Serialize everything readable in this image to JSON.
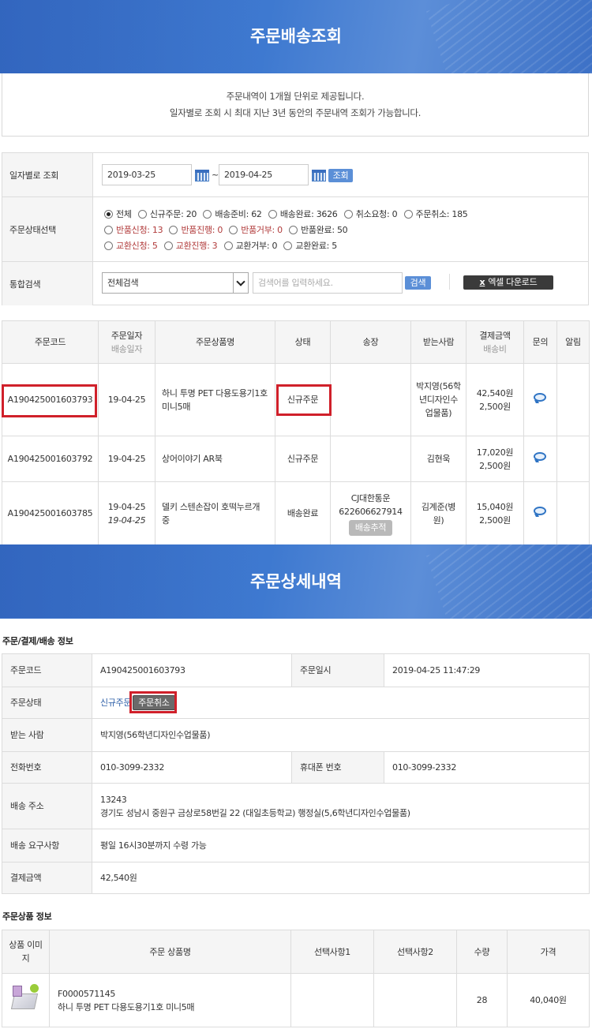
{
  "banner_top": {
    "title": "주문배송조회"
  },
  "notice": {
    "line1": "주문내역이 1개월 단위로 제공됩니다.",
    "line2": "일자별로 조회 시 최대 지난 3년 동안의 주문내역 조회가 가능합니다."
  },
  "search": {
    "date_label": "일자별로 조회",
    "date_from": "2019-03-25",
    "date_sep": "~",
    "date_to": "2019-04-25",
    "date_button": "조회",
    "status_label": "주문상태선택",
    "status_options": [
      [
        "전체",
        "신규주문: 20",
        "배송준비: 62",
        "배송완료: 3626",
        "취소요청: 0",
        "주문취소: 185"
      ],
      [
        "반품신청: 13",
        "반품진행: 0",
        "반품거부: 0",
        "반품완료: 50"
      ],
      [
        "교환신청: 5",
        "교환진행: 3",
        "교환거부: 0",
        "교환완료: 5"
      ]
    ],
    "integrated_label": "통합검색",
    "scope_selected": "전체검색",
    "keyword_placeholder": "검색어를 입력하세요.",
    "search_button": "검색",
    "excel_icon": "x",
    "excel_button": "엑셀 다운로드"
  },
  "orders": {
    "headers": {
      "code": "주문코드",
      "date": "주문일자",
      "date_sub": "배송일자",
      "product": "주문상품명",
      "status": "상태",
      "invoice": "송장",
      "receiver": "받는사람",
      "amount": "결제금액",
      "amount_sub": "배송비",
      "inquiry": "문의",
      "alert": "알림"
    },
    "rows": [
      {
        "code": "A190425001603793",
        "date": "19-04-25",
        "ship_date": "",
        "product": "하니 투명 PET 다용도용기1호 미니5매",
        "status": "신규주문",
        "carrier": "",
        "invoice": "",
        "track": "",
        "receiver": "박지영(56학년디자인수업물품)",
        "amount": "42,540원",
        "shipping": "2,500원"
      },
      {
        "code": "A190425001603792",
        "date": "19-04-25",
        "ship_date": "",
        "product": "상어이야기 AR북",
        "status": "신규주문",
        "carrier": "",
        "invoice": "",
        "track": "",
        "receiver": "김현욱",
        "amount": "17,020원",
        "shipping": "2,500원"
      },
      {
        "code": "A190425001603785",
        "date": "19-04-25",
        "ship_date": "19-04-25",
        "product": "델키 스텐손잡이 호떡누르개 중",
        "status": "배송완료",
        "carrier": "CJ대한통운",
        "invoice": "622606627914",
        "track": "배송추적",
        "receiver": "김계준(병원)",
        "amount": "15,040원",
        "shipping": "2,500원"
      }
    ]
  },
  "banner_detail": {
    "title": "주문상세내역"
  },
  "detail": {
    "section_title": "주문/결제/배송 정보",
    "code_label": "주문코드",
    "code": "A190425001603793",
    "datetime_label": "주문일시",
    "datetime": "2019-04-25 11:47:29",
    "status_label": "주문상태",
    "status": "신규주문",
    "cancel_button": "주문취소",
    "receiver_label": "받는 사람",
    "receiver": "박지영(56학년디자인수업물품)",
    "phone_label": "전화번호",
    "phone": "010-3099-2332",
    "mobile_label": "휴대폰 번호",
    "mobile": "010-3099-2332",
    "address_label": "배송 주소",
    "zip": "13243",
    "address": "경기도 성남시 중원구 금상로58번길 22 (대일초등학교) 행정실(5,6학년디자인수업물품)",
    "request_label": "배송 요구사항",
    "request": "평일 16시30분까지 수령 가능",
    "amount_label": "결제금액",
    "amount": "42,540원"
  },
  "products": {
    "section_title": "주문상품 정보",
    "headers": {
      "image": "상품 이미지",
      "name": "주문 상품명",
      "option1": "선택사항1",
      "option2": "선택사항2",
      "qty": "수량",
      "price": "가격"
    },
    "rows": [
      {
        "code": "F0000571145",
        "name": "하니 투명 PET 다용도용기1호 미니5매",
        "option1": "",
        "option2": "",
        "qty": "28",
        "price": "40,040원"
      }
    ]
  },
  "colors": {
    "accent": "#3e79d0",
    "highlight": "#d0202a",
    "status_new": "#2d5fa8"
  }
}
